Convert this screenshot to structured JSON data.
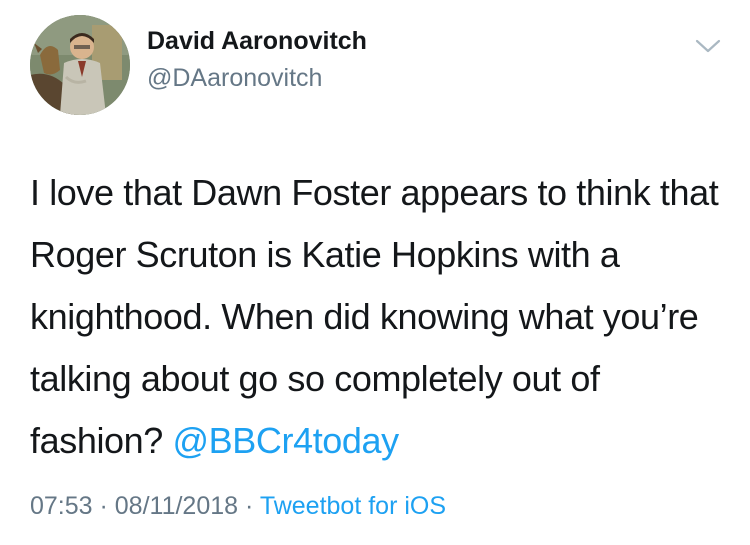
{
  "author": {
    "display_name": "David Aaronovitch",
    "handle": "@DAaronovitch"
  },
  "tweet": {
    "text": "I love that Dawn Foster appears to think that Roger Scruton is Katie Hopkins with a knighthood. When did knowing what you’re talking about go so completely out of fashion? ",
    "mention": "@BBCr4today"
  },
  "meta": {
    "time": "07:53",
    "separator": " · ",
    "date": "08/11/2018",
    "source": "Tweetbot for iOS"
  },
  "icons": {
    "menu": "chevron-down-icon",
    "avatar": "avatar-portrait"
  },
  "colors": {
    "link": "#1da1f2",
    "secondary_text": "#657786",
    "primary_text": "#14171a"
  }
}
